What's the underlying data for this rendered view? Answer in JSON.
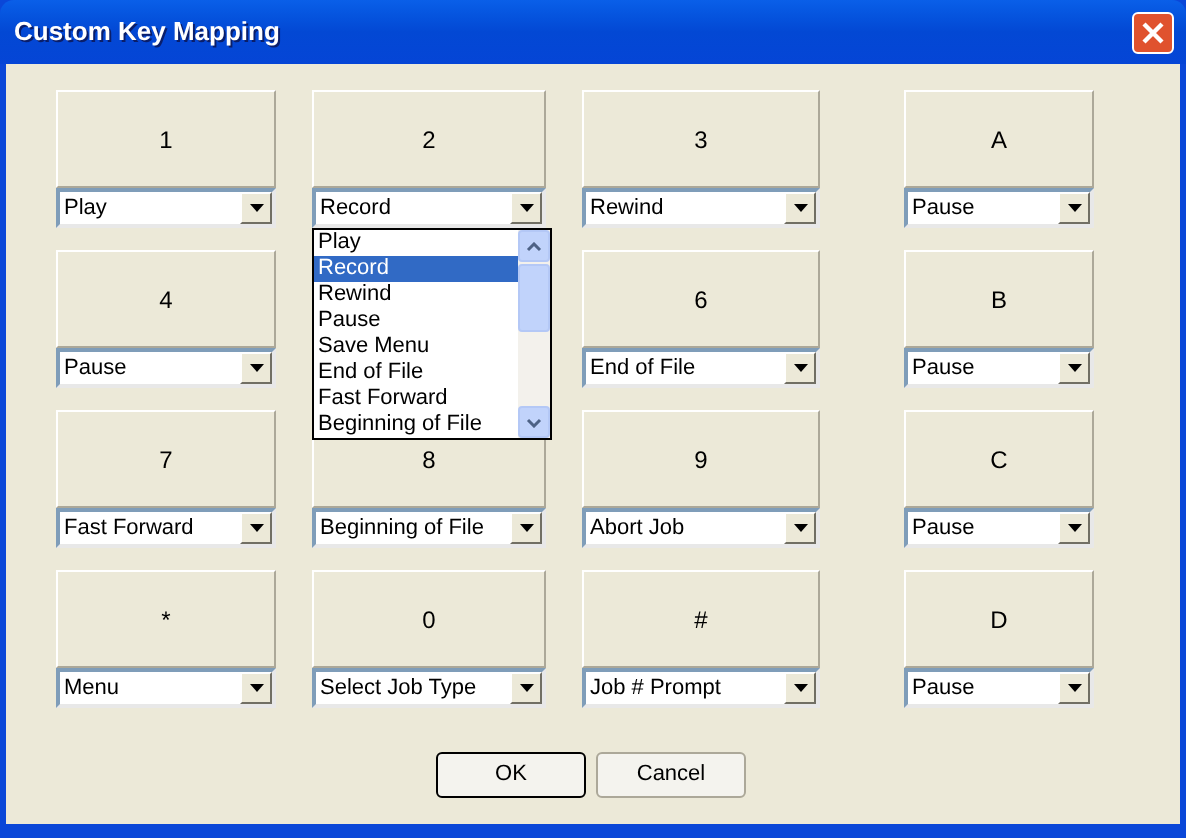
{
  "window": {
    "title": "Custom Key Mapping"
  },
  "keys": [
    {
      "label": "1",
      "action": "Play"
    },
    {
      "label": "2",
      "action": "Record",
      "open_list": {
        "items": [
          {
            "text": "Play",
            "selected": false
          },
          {
            "text": "Record",
            "selected": true
          },
          {
            "text": "Rewind",
            "selected": false
          },
          {
            "text": "Pause",
            "selected": false
          },
          {
            "text": "Save Menu",
            "selected": false
          },
          {
            "text": "End of File",
            "selected": false
          },
          {
            "text": "Fast Forward",
            "selected": false
          },
          {
            "text": "Beginning of File",
            "selected": false
          }
        ]
      }
    },
    {
      "label": "3",
      "action": "Rewind"
    },
    {
      "label": "A",
      "action": "Pause"
    },
    {
      "label": "4",
      "action": "Pause"
    },
    {
      "label": "6",
      "action": "End of File"
    },
    {
      "label": "B",
      "action": "Pause"
    },
    {
      "label": "7",
      "action": "Fast Forward"
    },
    {
      "label": "8",
      "action": "Beginning of File"
    },
    {
      "label": "9",
      "action": "Abort Job"
    },
    {
      "label": "C",
      "action": "Pause"
    },
    {
      "label": "*",
      "action": "Menu"
    },
    {
      "label": "0",
      "action": "Select Job Type"
    },
    {
      "label": "#",
      "action": "Job # Prompt"
    },
    {
      "label": "D",
      "action": "Pause"
    }
  ],
  "buttons": [
    "OK",
    "Cancel"
  ]
}
